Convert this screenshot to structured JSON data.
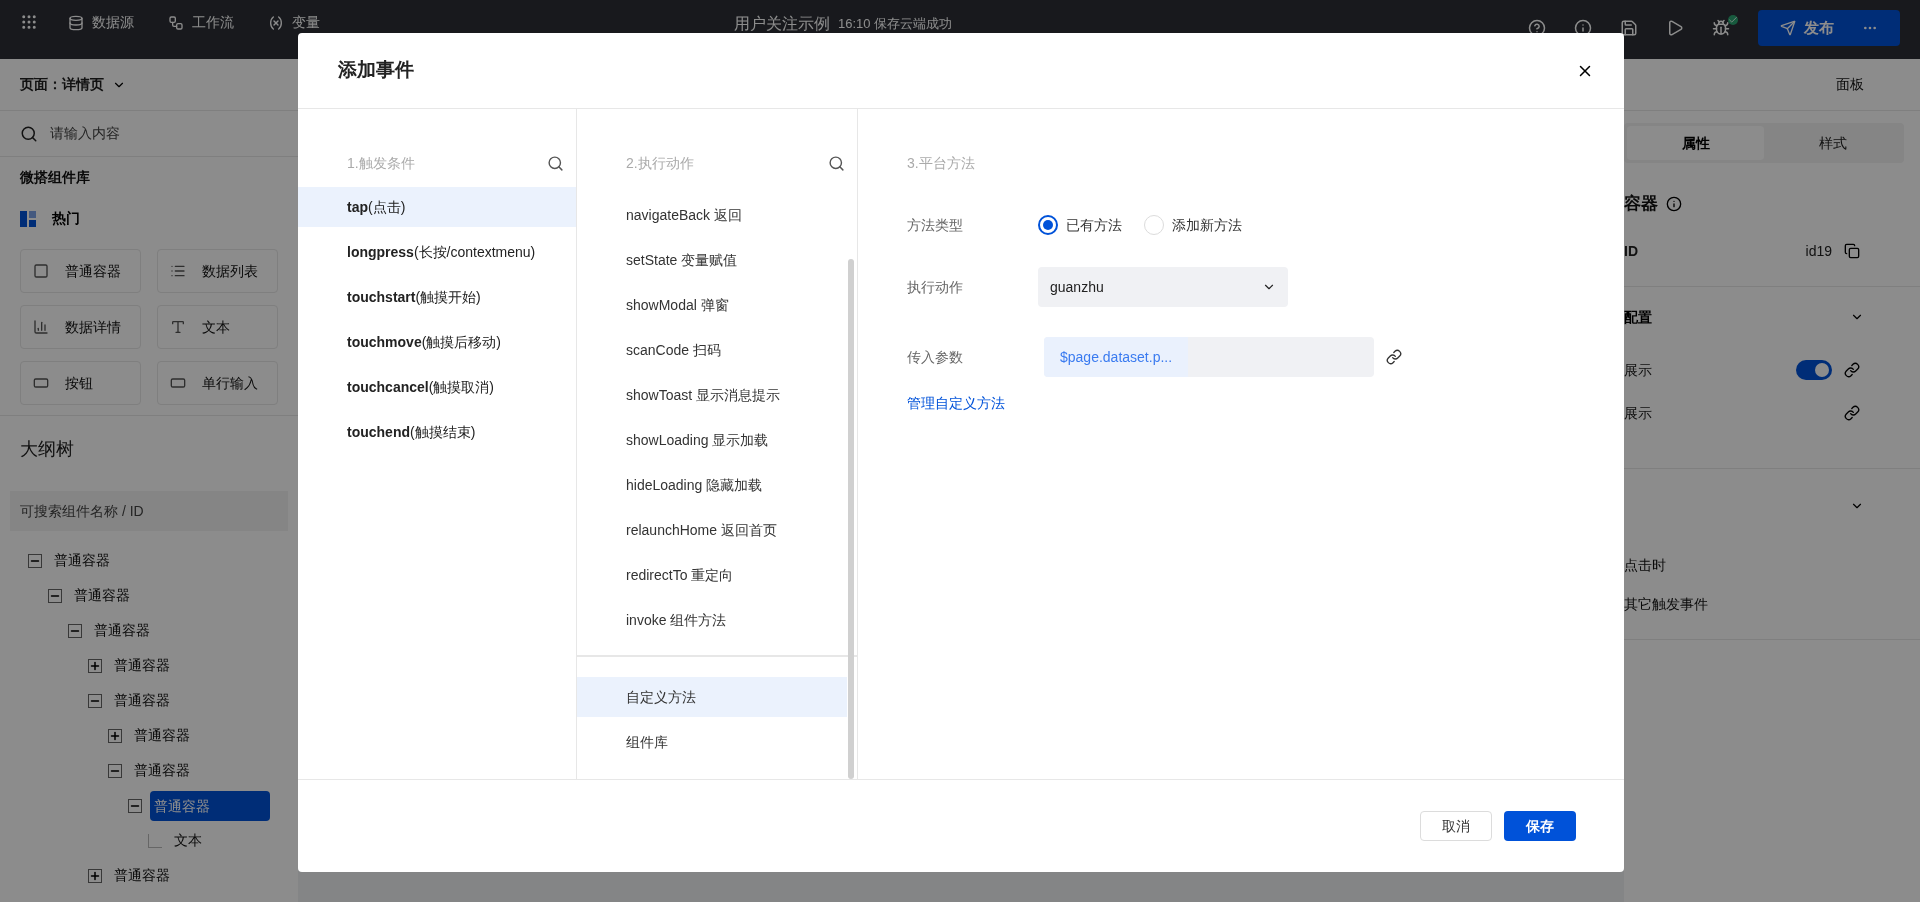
{
  "top_bar": {
    "nav": [
      "数据源",
      "工作流",
      "变量"
    ],
    "app_title": "用户关注示例",
    "save_status": "16:10 保存云端成功",
    "publish_button": "发布"
  },
  "left_panel": {
    "page_selector": "页面：详情页",
    "search": {
      "placeholder": "请输入内容"
    },
    "library_title": "微搭组件库",
    "category": "热门",
    "components": [
      "普通容器",
      "数据列表",
      "数据详情",
      "文本",
      "按钮",
      "单行输入"
    ],
    "outline_title": "大纲树",
    "outline_search": {
      "placeholder": "可搜索组件名称 / ID"
    },
    "tree": [
      {
        "label": "普通容器",
        "expanded": true,
        "selected": false,
        "children": [
          {
            "label": "普通容器",
            "expanded": true,
            "selected": false,
            "children": [
              {
                "label": "普通容器",
                "expanded": true,
                "selected": false,
                "children": [
                  {
                    "label": "普通容器",
                    "expanded": false,
                    "selected": false
                  },
                  {
                    "label": "普通容器",
                    "expanded": true,
                    "selected": false,
                    "children": [
                      {
                        "label": "普通容器",
                        "expanded": false,
                        "selected": false
                      },
                      {
                        "label": "普通容器",
                        "expanded": true,
                        "selected": false,
                        "children": [
                          {
                            "label": "普通容器",
                            "expanded": true,
                            "selected": true,
                            "children": [
                              {
                                "label": "文本",
                                "selected": false
                              }
                            ]
                          }
                        ]
                      }
                    ]
                  },
                  {
                    "label": "普通容器",
                    "expanded": false,
                    "selected": false
                  }
                ]
              }
            ]
          }
        ]
      }
    ]
  },
  "dialog": {
    "title": "添加事件",
    "triggers": {
      "heading": "1.触发条件",
      "items": [
        {
          "label": "**tap**(点击)",
          "selected": true
        },
        {
          "label": "**longpress**(长按/contextmenu)",
          "selected": false
        },
        {
          "label": "**touchstart**(触摸开始)",
          "selected": false
        },
        {
          "label": "**touchmove**(触摸后移动)",
          "selected": false
        },
        {
          "label": "**touchcancel**(触摸取消)",
          "selected": false
        },
        {
          "label": "**touchend**(触摸结束)",
          "selected": false
        }
      ]
    },
    "actions": {
      "heading": "2.执行动作",
      "items": [
        {
          "label": "navigateBack 返回",
          "selected": false
        },
        {
          "label": "setState 变量赋值",
          "selected": false
        },
        {
          "label": "showModal 弹窗",
          "selected": false
        },
        {
          "label": "scanCode 扫码",
          "selected": false
        },
        {
          "label": "showToast 显示消息提示",
          "selected": false
        },
        {
          "label": "showLoading 显示加载",
          "selected": false
        },
        {
          "label": "hideLoading 隐藏加载",
          "selected": false
        },
        {
          "label": "relaunchHome 返回首页",
          "selected": false
        },
        {
          "label": "redirectTo 重定向",
          "selected": false
        },
        {
          "label": "invoke 组件方法",
          "selected": false
        }
      ],
      "sections": [
        {
          "label": "自定义方法",
          "selected": true
        },
        {
          "label": "组件库",
          "selected": false
        }
      ]
    },
    "method": {
      "heading": "3.平台方法",
      "method_type": {
        "label": "方法类型",
        "options": [
          {
            "label": "已有方法",
            "selected": true
          },
          {
            "label": "添加新方法",
            "selected": false
          }
        ]
      },
      "action": {
        "label": "执行动作",
        "value": "guanzhu"
      },
      "params": {
        "label": "传入参数",
        "value": "$page.dataset.p..."
      },
      "manage_link": "管理自定义方法"
    },
    "buttons": {
      "cancel": "取消",
      "save": "保存"
    }
  },
  "right_panel": {
    "title": "面板",
    "tabs": [
      {
        "label": "属性",
        "selected": true
      },
      {
        "label": "样式",
        "selected": false
      }
    ],
    "component_name": "容器",
    "id_label": "ID",
    "id_value": "id19",
    "section": "配置",
    "rows": [
      {
        "label": "展示",
        "kind": "switch",
        "on": true
      },
      {
        "label": "展示",
        "kind": "plain"
      }
    ],
    "events": [
      "点击时",
      "其它触发事件"
    ]
  }
}
